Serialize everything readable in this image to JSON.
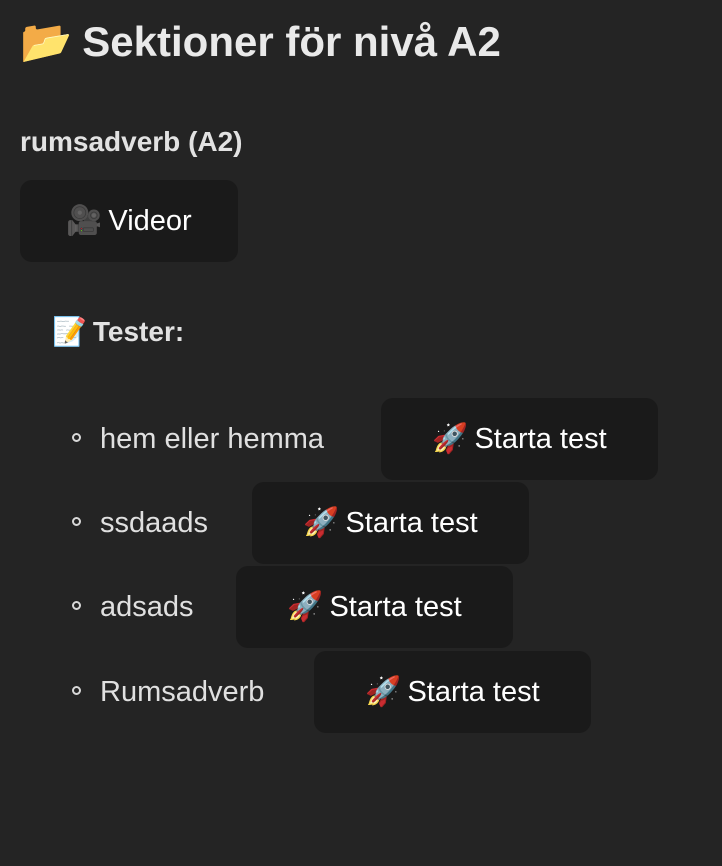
{
  "page": {
    "title_icon": "📂",
    "title": "Sektioner för nivå A2"
  },
  "section": {
    "title": "rumsadverb (A2)",
    "videos_button": {
      "icon": "🎥",
      "label": "Videor"
    },
    "tests": {
      "heading_icon": "📝",
      "heading": "Tester:",
      "items": [
        {
          "name": "hem eller hemma",
          "button_icon": "🚀",
          "button_label": "Starta test"
        },
        {
          "name": "ssdaads",
          "button_icon": "🚀",
          "button_label": "Starta test"
        },
        {
          "name": "adsads",
          "button_icon": "🚀",
          "button_label": "Starta test"
        },
        {
          "name": "Rumsadverb",
          "button_icon": "🚀",
          "button_label": "Starta test"
        }
      ]
    }
  },
  "colors": {
    "background": "#242424",
    "button_background": "#1a1a1a",
    "text": "#e6e6e6"
  },
  "icons": {
    "title": "folder-icon",
    "videos": "video-camera-icon",
    "tests": "memo-icon",
    "start_test": "rocket-icon"
  }
}
